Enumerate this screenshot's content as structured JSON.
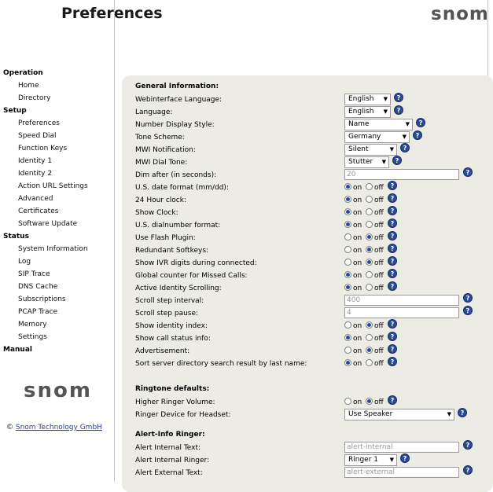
{
  "header": {
    "title": "Preferences",
    "logo": "snom"
  },
  "sidebar": {
    "sections": [
      {
        "title": "Operation",
        "items": [
          "Home",
          "Directory"
        ]
      },
      {
        "title": "Setup",
        "items": [
          "Preferences",
          "Speed Dial",
          "Function Keys",
          "Identity 1",
          "Identity 2",
          "Action URL Settings",
          "Advanced",
          "Certificates",
          "Software Update"
        ]
      },
      {
        "title": "Status",
        "items": [
          "System Information",
          "Log",
          "SIP Trace",
          "DNS Cache",
          "Subscriptions",
          "PCAP Trace",
          "Memory",
          "Settings"
        ]
      },
      {
        "title": "Manual",
        "items": []
      }
    ],
    "logo": "snom",
    "copyright_prefix": "©",
    "copyright_link": "Snom Technology GmbH"
  },
  "general": {
    "heading": "General Information:",
    "help_glyph": "?",
    "radio_on": "on",
    "radio_off": "off",
    "rows": [
      {
        "label": "Webinterface Language:",
        "type": "select",
        "value": "English"
      },
      {
        "label": "Language:",
        "type": "select",
        "value": "English"
      },
      {
        "label": "Number Display Style:",
        "type": "select",
        "value": "Name"
      },
      {
        "label": "Tone Scheme:",
        "type": "select",
        "value": "Germany"
      },
      {
        "label": "MWI Notification:",
        "type": "select",
        "value": "Silent"
      },
      {
        "label": "MWI Dial Tone:",
        "type": "select",
        "value": "Stutter"
      },
      {
        "label": "Dim after (in seconds):",
        "type": "text",
        "value": "20"
      },
      {
        "label": "U.S. date format (mm/dd):",
        "type": "radio",
        "value": "on"
      },
      {
        "label": "24 Hour clock:",
        "type": "radio",
        "value": "on"
      },
      {
        "label": "Show Clock:",
        "type": "radio",
        "value": "on"
      },
      {
        "label": "U.S. dialnumber format:",
        "type": "radio",
        "value": "on"
      },
      {
        "label": "Use Flash Plugin:",
        "type": "radio",
        "value": "off"
      },
      {
        "label": "Redundant Softkeys:",
        "type": "radio",
        "value": "off"
      },
      {
        "label": "Show IVR digits during connected:",
        "type": "radio",
        "value": "off"
      },
      {
        "label": "Global counter for Missed Calls:",
        "type": "radio",
        "value": "on"
      },
      {
        "label": "Active Identity Scrolling:",
        "type": "radio",
        "value": "on"
      },
      {
        "label": "Scroll step interval:",
        "type": "text",
        "value": "400"
      },
      {
        "label": "Scroll step pause:",
        "type": "text",
        "value": "4"
      },
      {
        "label": "Show identity index:",
        "type": "radio",
        "value": "off"
      },
      {
        "label": "Show call status info:",
        "type": "radio",
        "value": "on"
      },
      {
        "label": "Advertisement:",
        "type": "radio",
        "value": "off"
      },
      {
        "label": "Sort server directory search result by last name:",
        "type": "radio",
        "value": "on"
      }
    ]
  },
  "ringtone": {
    "heading": "Ringtone defaults:",
    "rows": [
      {
        "label": "Higher Ringer Volume:",
        "type": "radio",
        "value": "off"
      },
      {
        "label": "Ringer Device for Headset:",
        "type": "select",
        "value": "Use Speaker"
      }
    ]
  },
  "alert": {
    "heading": "Alert-Info Ringer:",
    "rows": [
      {
        "label": "Alert Internal Text:",
        "type": "text",
        "value": "alert-internal"
      },
      {
        "label": "Alert Internal Ringer:",
        "type": "select",
        "value": "Ringer 1"
      },
      {
        "label": "Alert External Text:",
        "type": "text",
        "value": "alert-external"
      }
    ]
  }
}
